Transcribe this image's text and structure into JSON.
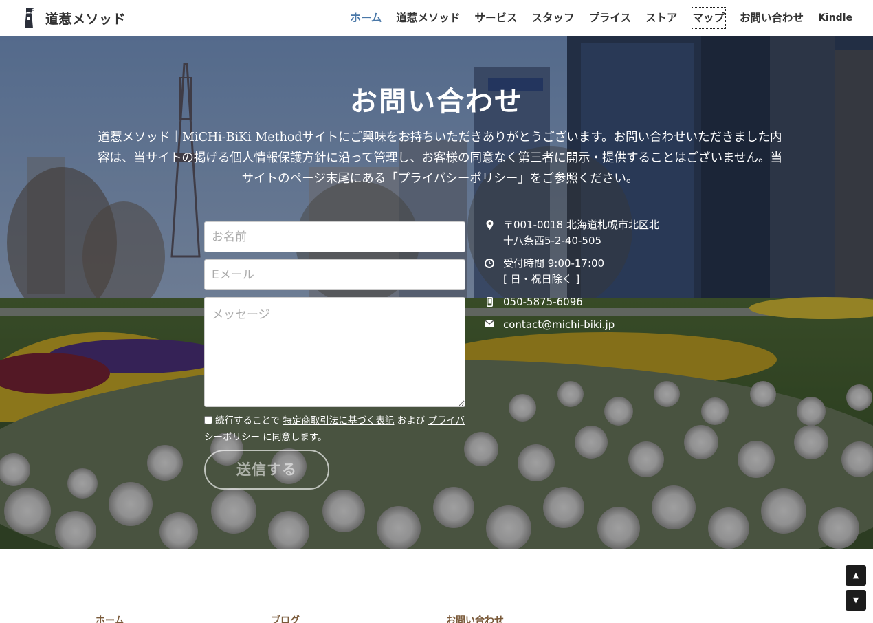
{
  "header": {
    "brand_name": "道惹メソッド",
    "nav": [
      {
        "label": "ホーム"
      },
      {
        "label": "道惹メソッド"
      },
      {
        "label": "サービス"
      },
      {
        "label": "スタッフ"
      },
      {
        "label": "プライス"
      },
      {
        "label": "ストア"
      },
      {
        "label": "マップ"
      },
      {
        "label": "お問い合わせ"
      },
      {
        "label": "Kindle"
      }
    ]
  },
  "hero": {
    "title": "お問い合わせ",
    "lead": "道惹メソッド｜MiCHi-BiKi Methodサイトにご興味をお持ちいただきありがとうございます。お問い合わせいただきました内容は、当サイトの掲げる個人情報保護方針に沿って管理し、お客様の同意なく第三者に開示・提供することはございません。当サイトのページ末尾にある「プライバシーポリシー」をご参照ください。"
  },
  "form": {
    "name_placeholder": "お名前",
    "email_placeholder": "Eメール",
    "message_placeholder": "メッセージ",
    "consent_prefix": "続行することで",
    "consent_link1": "特定商取引法に基づく表記",
    "consent_middle": "および",
    "consent_link2": "プライバシーポリシー",
    "consent_suffix": "に同意します。",
    "submit_label": "送信する"
  },
  "contact": {
    "address_line1": "〒001-0018 北海道札幌市北区北",
    "address_line2": "十八条西5-2-40-505",
    "hours_line1": "受付時間 9:00-17:00",
    "hours_line2": "[ 日・祝日除く ]",
    "phone": "050-5875-6096",
    "email": "contact@michi-biki.jp"
  },
  "footer": {
    "links": [
      {
        "label": "ホーム"
      },
      {
        "label": "ブログ"
      },
      {
        "label": "お問い合わせ"
      }
    ]
  },
  "scroll": {
    "up_icon": "▲",
    "down_icon": "▼"
  },
  "colors": {
    "nav_active": "#4a78a8",
    "footer_link": "#7a5a3a"
  }
}
